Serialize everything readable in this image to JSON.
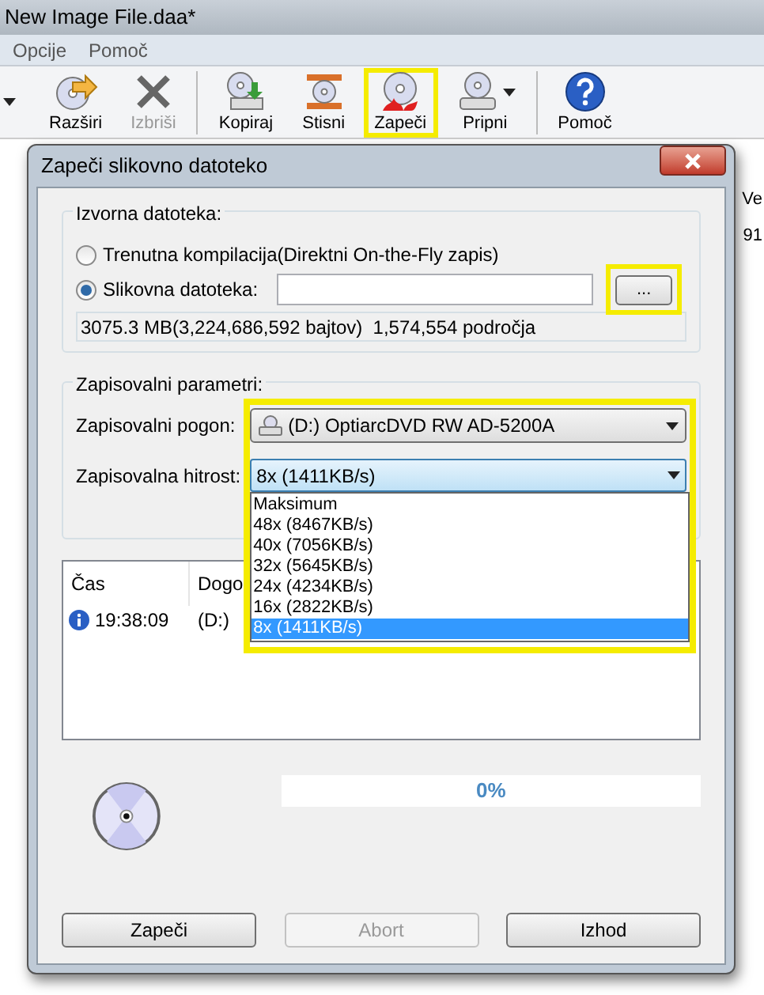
{
  "app": {
    "title": "New Image File.daa*",
    "menu": [
      "Opcije",
      "Pomoč"
    ],
    "toolbar_groups": [
      [
        {
          "label": "Razširi",
          "kind": "extract",
          "disabled": false,
          "highlighted": false,
          "dropdown": false
        },
        {
          "label": "Izbriši",
          "kind": "delete",
          "disabled": true,
          "highlighted": false,
          "dropdown": false
        }
      ],
      [
        {
          "label": "Kopiraj",
          "kind": "copy",
          "disabled": false,
          "highlighted": false,
          "dropdown": false
        },
        {
          "label": "Stisni",
          "kind": "compress",
          "disabled": false,
          "highlighted": false,
          "dropdown": false
        },
        {
          "label": "Zapeči",
          "kind": "burn",
          "disabled": false,
          "highlighted": true,
          "dropdown": false
        },
        {
          "label": "Pripni",
          "kind": "mount",
          "disabled": false,
          "highlighted": false,
          "dropdown": true
        }
      ],
      [
        {
          "label": "Pomoč",
          "kind": "help",
          "disabled": false,
          "highlighted": false,
          "dropdown": false
        }
      ]
    ],
    "side_text": [
      "Ve",
      "91"
    ]
  },
  "dialog": {
    "title": "Zapeči slikovno datoteko",
    "source": {
      "title": "Izvorna datoteka:",
      "options": [
        {
          "label": "Trenutna kompilacija(Direktni On-the-Fly zapis)",
          "selected": false
        },
        {
          "label": "Slikovna datoteka:",
          "selected": true
        }
      ],
      "browse": {
        "label": "...",
        "highlighted": true
      },
      "info": "3075.3 MB(3,224,686,592 bajtov)  1,574,554 področja"
    },
    "params": {
      "title": "Zapisovalni parametri:",
      "highlighted": true,
      "drive_label": "Zapisovalni pogon:",
      "drive": "(D:) OptiarcDVD RW AD-5200A",
      "speed_label": "Zapisovalna hitrost:",
      "speed": "8x (1411KB/s)",
      "speed_options": [
        {
          "label": "Maksimum",
          "selected": false
        },
        {
          "label": "48x (8467KB/s)",
          "selected": false
        },
        {
          "label": "40x (7056KB/s)",
          "selected": false
        },
        {
          "label": "32x (5645KB/s)",
          "selected": false
        },
        {
          "label": "24x (4234KB/s)",
          "selected": false
        },
        {
          "label": "16x (2822KB/s)",
          "selected": false
        },
        {
          "label": "8x (1411KB/s)",
          "selected": true
        }
      ]
    },
    "log": {
      "columns": [
        "Čas",
        "Dogo"
      ],
      "rows": [
        {
          "time": "19:38:09",
          "event": "(D:)"
        }
      ]
    },
    "progress": {
      "level": 0,
      "label": "0%"
    },
    "buttons": [
      {
        "label": "Zapeči",
        "disabled": false
      },
      {
        "label": "Abort",
        "disabled": true
      },
      {
        "label": "Izhod",
        "disabled": false
      }
    ]
  }
}
